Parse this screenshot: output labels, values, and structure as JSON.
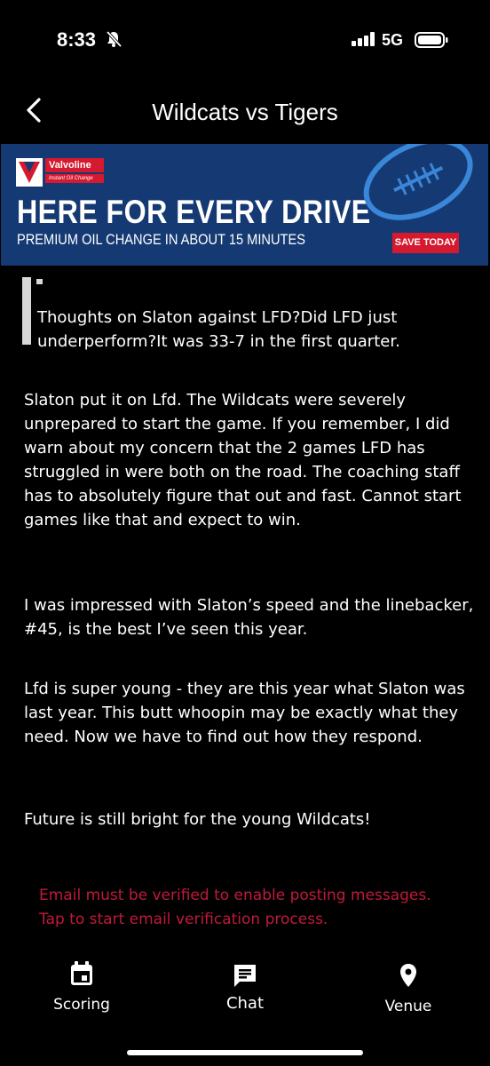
{
  "status_bar": {
    "time": "8:33",
    "network": "5G"
  },
  "header": {
    "title": "Wildcats vs Tigers"
  },
  "ad": {
    "brand": "Valvoline",
    "brand_tagline": "Instant Oil Change",
    "headline": "HERE FOR EVERY DRIVE",
    "subheadline": "PREMIUM OIL CHANGE IN ABOUT 15 MINUTES",
    "cta": "SAVE TODAY",
    "colors": {
      "background": "#153a73",
      "accent": "#d5192e"
    }
  },
  "post": {
    "quote": "Thoughts on Slaton against LFD?Did LFD just underperform?It was 33-7 in the first quarter.",
    "paragraphs": [
      "Slaton put it on Lfd. The Wildcats were severely unprepared to start the game. If you remember, I did warn about my concern that the 2 games LFD has struggled in were both on the road. The coaching staff has to absolutely figure that out and fast. Cannot start games like that and expect to win.",
      "I was impressed with Slaton’s speed and the linebacker, #45, is the best I’ve seen this year.",
      "Lfd is super young - they are this year what Slaton was last year. This butt whoopin may be exactly what they need. Now we have to find out how they respond.",
      "Future is still bright for the young Wildcats!"
    ]
  },
  "verification": {
    "line1": "Email must be verified to enable posting messages.",
    "line2": "Tap to start email verification process.",
    "color": "#c01a3a"
  },
  "tabs": [
    {
      "label": "Scoring",
      "icon": "calendar-icon"
    },
    {
      "label": "Chat",
      "icon": "chat-icon"
    },
    {
      "label": "Venue",
      "icon": "location-pin-icon"
    }
  ]
}
